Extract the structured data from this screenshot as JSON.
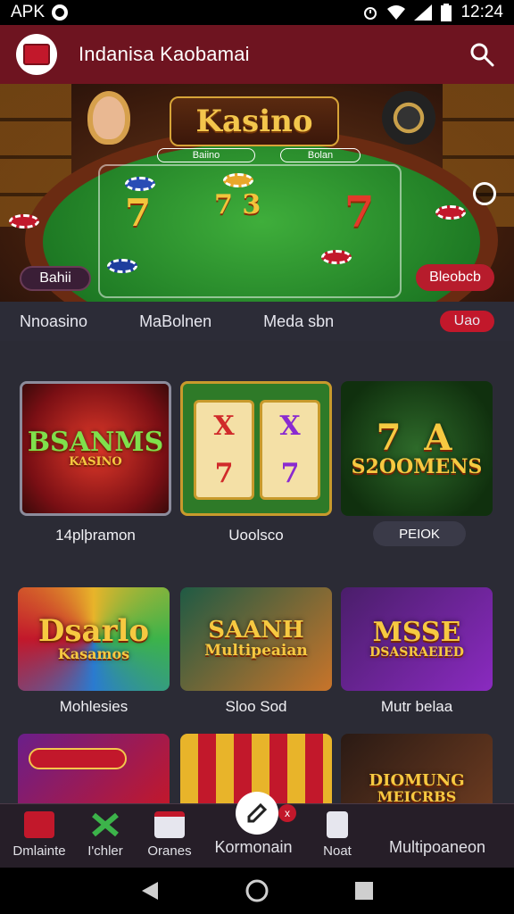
{
  "status_bar": {
    "left_text": "APK",
    "time": "12:24",
    "left_icon": "ring-icon",
    "right_icons": [
      "alarm-icon",
      "wifi-icon",
      "signal-icon",
      "battery-icon"
    ]
  },
  "app_bar": {
    "title": "Indanisa Kaobamai",
    "logo_icon": "casino-logo-icon",
    "search_icon": "search-icon"
  },
  "hero": {
    "title": "Kasino",
    "left_button": "Bahii",
    "right_button": "Bleobcb",
    "table_left_label": "Baiino",
    "table_right_label": "Bolan"
  },
  "tabs": {
    "items": [
      "Nnoasino",
      "MaBolnen",
      "Meda sbn"
    ],
    "active": "Uao"
  },
  "games": [
    {
      "art": "BSANMS",
      "art_sub": "KASINO",
      "label": "14plþramon"
    },
    {
      "art": "7",
      "label": "Uoolsco"
    },
    {
      "art": "S2OOMENS",
      "label": "PEIOK"
    },
    {
      "art": "Dsarlo",
      "art_sub": "Kasamos",
      "label": "Mohlesies"
    },
    {
      "art": "SAANH",
      "art_sub": "Multipeaian",
      "label": "Sloo Sod"
    },
    {
      "art": "MSSE",
      "art_sub": "DSASRAEIED",
      "label": "Mutr belaa"
    },
    {
      "art": "",
      "label": ""
    },
    {
      "art": "",
      "label": ""
    },
    {
      "art": "DIOMUNG",
      "art_sub": "MEICRBS",
      "label": ""
    }
  ],
  "bottom_nav": {
    "items": [
      {
        "label": "Dmlainte",
        "icon": "folder-icon"
      },
      {
        "label": "I'chler",
        "icon": "xbox-icon"
      },
      {
        "label": "Oranes",
        "icon": "game-box-icon"
      },
      {
        "label": "Kormonain",
        "icon": "edit-pen-icon"
      },
      {
        "label": "Noat",
        "icon": "document-icon"
      },
      {
        "label": "Multipoaneon",
        "icon": "none"
      }
    ],
    "badge_text": "x"
  },
  "colors": {
    "brand": "#6e1420",
    "accent": "#c2182b",
    "background": "#2b2b35"
  }
}
